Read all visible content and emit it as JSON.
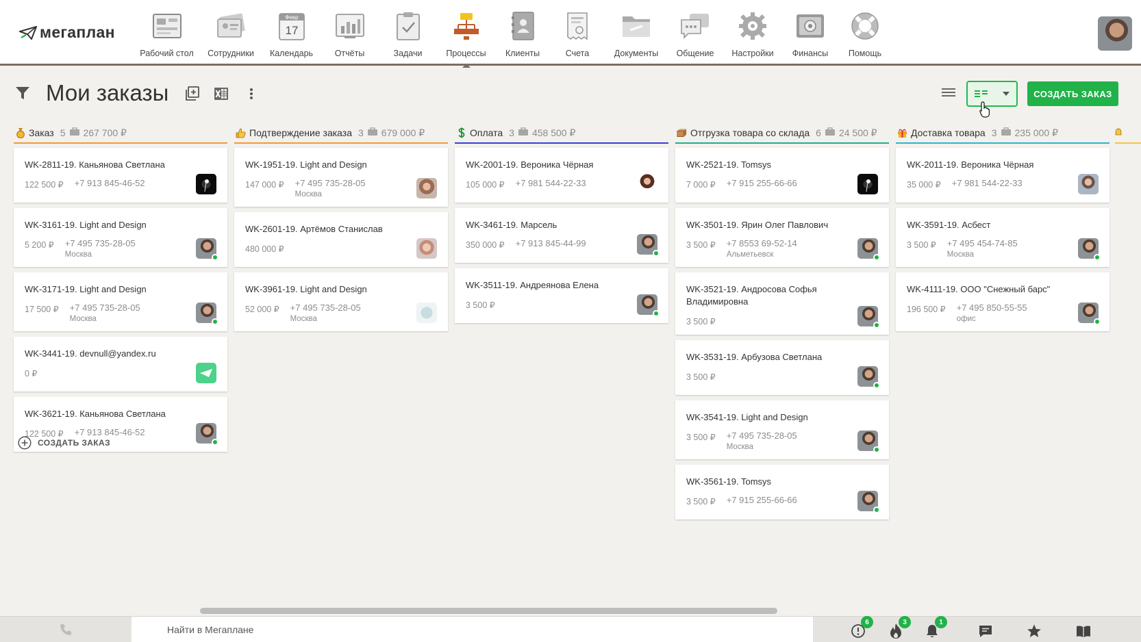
{
  "app": {
    "logo_text": "мегаплан"
  },
  "nav": [
    {
      "label": "Рабочий стол",
      "icon": "desktop-icon"
    },
    {
      "label": "Сотрудники",
      "icon": "employees-icon"
    },
    {
      "label": "Календарь",
      "icon": "calendar-icon",
      "cal_month": "Февр",
      "cal_day": "17"
    },
    {
      "label": "Отчёты",
      "icon": "reports-icon"
    },
    {
      "label": "Задачи",
      "icon": "tasks-icon"
    },
    {
      "label": "Процессы",
      "icon": "processes-icon",
      "active": true
    },
    {
      "label": "Клиенты",
      "icon": "clients-icon"
    },
    {
      "label": "Счета",
      "icon": "invoices-icon"
    },
    {
      "label": "Документы",
      "icon": "documents-icon"
    },
    {
      "label": "Общение",
      "icon": "chat-icon"
    },
    {
      "label": "Настройки",
      "icon": "settings-icon"
    },
    {
      "label": "Финансы",
      "icon": "finance-icon"
    },
    {
      "label": "Помощь",
      "icon": "help-icon"
    }
  ],
  "toolbar": {
    "title": "Мои заказы",
    "create_button": "СОЗДАТЬ ЗАКАЗ"
  },
  "columns": [
    {
      "title": "Заказ",
      "count": "5",
      "sum": "267 700 ₽",
      "color": "#f29a38",
      "emoji": "money-bag-icon",
      "cards": [
        {
          "title": "WK-2811-19. Каньянова Светлана",
          "price": "122 500 ₽",
          "phone": "+7 913 845-46-52",
          "city": "",
          "avatar": "av-dark",
          "online": false
        },
        {
          "title": "WK-3161-19. Light and Design",
          "price": "5 200 ₽",
          "phone": "+7 495 735-28-05",
          "city": "Москва",
          "avatar": "av-man",
          "online": true
        },
        {
          "title": "WK-3171-19. Light and Design",
          "price": "17 500 ₽",
          "phone": "+7 495 735-28-05",
          "city": "Москва",
          "avatar": "av-man",
          "online": true
        },
        {
          "title": "WK-3441-19. devnull@yandex.ru",
          "price": "0 ₽",
          "phone": "",
          "city": "",
          "avatar": "av-logo",
          "online": false
        },
        {
          "title": "WK-3621-19. Каньянова Светлана",
          "price": "122 500 ₽",
          "phone": "+7 913 845-46-52",
          "city": "",
          "avatar": "av-man",
          "online": true
        }
      ]
    },
    {
      "title": "Подтверждение заказа",
      "count": "3",
      "sum": "679 000 ₽",
      "color": "#f29a38",
      "emoji": "thumbs-up-icon",
      "cards": [
        {
          "title": "WK-1951-19. Light and Design",
          "price": "147 000 ₽",
          "phone": "+7 495 735-28-05",
          "city": "Москва",
          "avatar": "av-girl1",
          "online": false
        },
        {
          "title": "WK-2601-19. Артёмов Станислав",
          "price": "480 000 ₽",
          "phone": "",
          "city": "",
          "avatar": "av-girl2",
          "online": false
        },
        {
          "title": "WK-3961-19. Light and Design",
          "price": "52 000 ₽",
          "phone": "+7 495 735-28-05",
          "city": "Москва",
          "avatar": "av-pale",
          "online": false
        }
      ]
    },
    {
      "title": "Оплата",
      "count": "3",
      "sum": "458 500 ₽",
      "color": "#3a3ed8",
      "emoji": "dollar-icon",
      "cards": [
        {
          "title": "WK-2001-19. Вероника Чёрная",
          "price": "105 000 ₽",
          "phone": "+7 981 544-22-33",
          "city": "",
          "avatar": "av-woman",
          "online": false
        },
        {
          "title": "WK-3461-19. Марсель",
          "price": "350 000 ₽",
          "phone": "+7 913 845-44-99",
          "city": "",
          "avatar": "av-man",
          "online": true
        },
        {
          "title": "WK-3511-19. Андреянова Елена",
          "price": "3 500 ₽",
          "phone": "",
          "city": "",
          "avatar": "av-man",
          "online": true
        }
      ]
    },
    {
      "title": "Отгрузка товара со склада",
      "count": "6",
      "sum": "24 500 ₽",
      "color": "#1fae8c",
      "emoji": "package-icon",
      "cards": [
        {
          "title": "WK-2521-19. Tomsys",
          "price": "7 000 ₽",
          "phone": "+7 915 255-66-66",
          "city": "",
          "avatar": "av-dark",
          "online": false
        },
        {
          "title": "WK-3501-19. Ярин Олег Павлович",
          "price": "3 500 ₽",
          "phone": "+7 8553 69-52-14",
          "city": "Альметьевск",
          "avatar": "av-man",
          "online": true
        },
        {
          "title": "WK-3521-19. Андросова Софья Владимировна",
          "price": "3 500 ₽",
          "phone": "",
          "city": "",
          "avatar": "av-man",
          "online": true
        },
        {
          "title": "WK-3531-19. Арбузова Светлана",
          "price": "3 500 ₽",
          "phone": "",
          "city": "",
          "avatar": "av-man",
          "online": true
        },
        {
          "title": "WK-3541-19. Light and Design",
          "price": "3 500 ₽",
          "phone": "+7 495 735-28-05",
          "city": "Москва",
          "avatar": "av-man",
          "online": true
        },
        {
          "title": "WK-3561-19. Tomsys",
          "price": "3 500 ₽",
          "phone": "+7 915 255-66-66",
          "city": "",
          "avatar": "av-man",
          "online": true
        }
      ]
    },
    {
      "title": "Доставка товара",
      "count": "3",
      "sum": "235 000 ₽",
      "color": "#2ab6c9",
      "emoji": "gift-icon",
      "cards": [
        {
          "title": "WK-2011-19. Вероника Чёрная",
          "price": "35 000 ₽",
          "phone": "+7 981 544-22-33",
          "city": "",
          "avatar": "av-guy2",
          "online": false
        },
        {
          "title": "WK-3591-19. Асбест",
          "price": "3 500 ₽",
          "phone": "+7 495 454-74-85",
          "city": "Москва",
          "avatar": "av-man",
          "online": true
        },
        {
          "title": "WK-4111-19. ООО \"Снежный барс\"",
          "price": "196 500 ₽",
          "phone": "+7 495 850-55-55",
          "city": "офис",
          "avatar": "av-man",
          "online": true
        }
      ]
    }
  ],
  "add_order_label": "СОЗДАТЬ ЗАКАЗ",
  "bottom": {
    "search_placeholder": "Найти в Мегаплане",
    "badges": {
      "alerts": "6",
      "hot": "3",
      "notifications": "1"
    }
  },
  "colors": {
    "accent": "#21b24a",
    "nav_border": "#7a6e65"
  }
}
